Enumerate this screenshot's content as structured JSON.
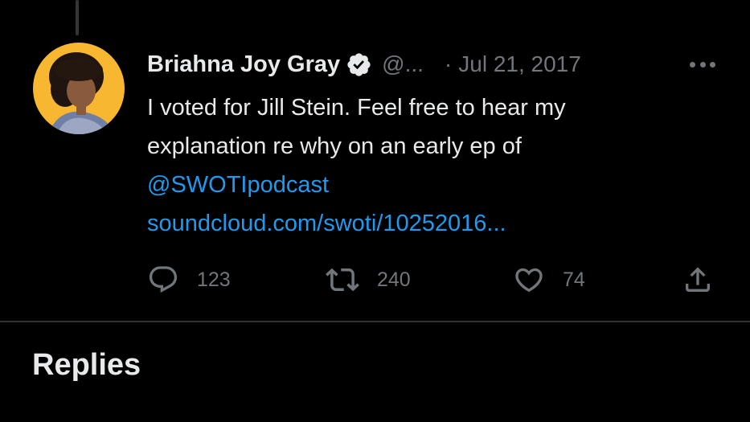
{
  "tweet": {
    "author_name": "Briahna Joy Gray",
    "handle": "@...",
    "separator": "·",
    "date": "Jul 21, 2017",
    "text_lines": [
      "I voted for Jill Stein. Feel free to hear my",
      "explanation re why on an early ep of"
    ],
    "mention": "@SWOTIpodcast",
    "link": "soundcloud.com/swoti/10252016...",
    "actions": {
      "reply_icon": "reply-bubble-icon",
      "reply_count": "123",
      "retweet_icon": "retweet-icon",
      "retweet_count": "240",
      "like_icon": "heart-icon",
      "like_count": "74",
      "share_icon": "share-icon"
    }
  },
  "section": {
    "replies_title": "Replies"
  },
  "colors": {
    "background": "#000000",
    "text_primary": "#e7e9ea",
    "text_secondary": "#71767b",
    "link": "#1d9bf0",
    "divider": "#2f3336",
    "avatar_background": "#f7b731"
  }
}
